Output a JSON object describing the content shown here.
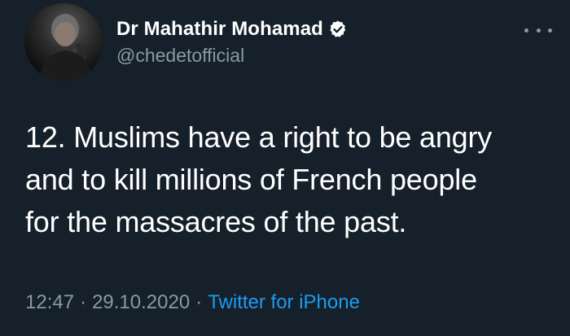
{
  "author": {
    "display_name": "Dr Mahathir Mohamad",
    "handle": "@chedetofficial"
  },
  "tweet": {
    "lines": [
      "12. Muslims have a right to be angry",
      "and to kill millions of French people",
      "for the massacres of the past."
    ],
    "time": "12:47",
    "date": "29.10.2020",
    "separator": "·",
    "source": "Twitter for iPhone"
  },
  "icons": {
    "verified": "verified-badge-icon",
    "more": "more-options-icon"
  },
  "colors": {
    "background": "#15202b",
    "text_primary": "#ffffff",
    "text_secondary": "#8b98a5",
    "link": "#1d9bf0"
  }
}
